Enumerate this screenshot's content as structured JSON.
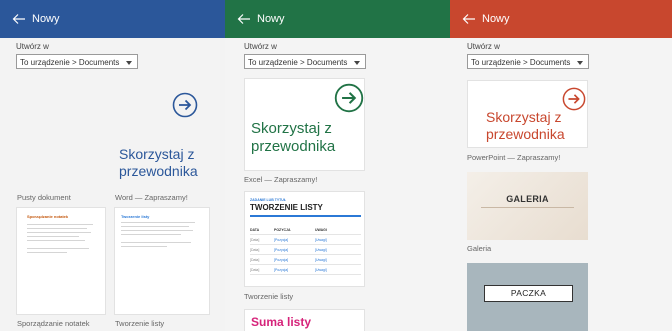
{
  "panels": [
    {
      "header": "Nowy",
      "section_label": "Utwórz w",
      "location": "To urządzenie > Documents",
      "templates": [
        {
          "caption": "Pusty dokument"
        },
        {
          "caption": "Word — Zapraszamy!",
          "preview_title": "Skorzystaj z przewodnika"
        },
        {
          "caption": "Sporządzanie notatek",
          "preview_title": "Sporządzanie notatek"
        },
        {
          "caption": "Tworzenie listy",
          "preview_title": "Tworzenie listy"
        }
      ],
      "accent": "#2b579a"
    },
    {
      "header": "Nowy",
      "section_label": "Utwórz w",
      "location": "To urządzenie > Documents",
      "templates": [
        {
          "caption": "Excel — Zapraszamy!",
          "preview_title": "Skorzystaj z przewodnika"
        },
        {
          "caption": "Tworzenie listy",
          "preview_subtitle": "ZADANIE LUB TYTUŁ",
          "preview_title": "TWORZENIE LISTY",
          "columns": [
            "DATA",
            "POZYCJA",
            "UWAGI"
          ],
          "rows": [
            [
              "[Data]",
              "[Pozycja]",
              "[Uwagi]"
            ],
            [
              "[Data]",
              "[Pozycja]",
              "[Uwagi]"
            ],
            [
              "[Data]",
              "[Pozycja]",
              "[Uwagi]"
            ],
            [
              "[Data]",
              "[Pozycja]",
              "[Uwagi]"
            ]
          ]
        },
        {
          "preview_title": "Suma listy"
        }
      ],
      "accent": "#217346"
    },
    {
      "header": "Nowy",
      "section_label": "Utwórz w",
      "location": "To urządzenie > Documents",
      "templates": [
        {
          "caption": "PowerPoint — Zapraszamy!",
          "preview_title": "Skorzystaj z przewodnika"
        },
        {
          "caption": "Galeria",
          "preview_title": "GALERIA"
        },
        {
          "preview_title": "PACZKA"
        }
      ],
      "accent": "#c8472e"
    }
  ],
  "icons": {
    "back": "back-arrow-icon",
    "arrow": "arrow-circle-right-icon",
    "dropdown": "chevron-down-icon"
  }
}
